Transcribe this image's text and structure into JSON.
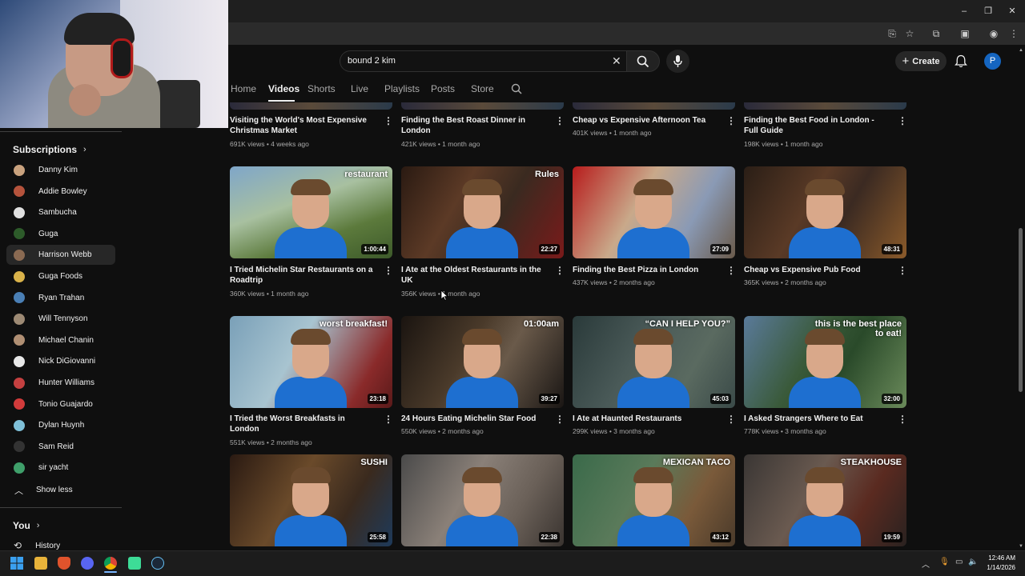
{
  "search": {
    "query": "bound 2 kim"
  },
  "header": {
    "create_label": "Create",
    "account_initial": "P"
  },
  "channel_tabs": [
    "Home",
    "Videos",
    "Shorts",
    "Live",
    "Playlists",
    "Posts",
    "Store"
  ],
  "sidebar": {
    "subscriptions_heading": "Subscriptions",
    "subscriptions": [
      {
        "name": "Danny Kim",
        "color": "#c9a27e"
      },
      {
        "name": "Addie Bowley",
        "color": "#b5533c"
      },
      {
        "name": "Sambucha",
        "color": "#e0e0e0"
      },
      {
        "name": "Guga",
        "color": "#2d5b2a"
      },
      {
        "name": "Harrison Webb",
        "color": "#8a6a52"
      },
      {
        "name": "Guga Foods",
        "color": "#d9b24a"
      },
      {
        "name": "Ryan Trahan",
        "color": "#4a7fb5"
      },
      {
        "name": "Will Tennyson",
        "color": "#9d8a74"
      },
      {
        "name": "Michael Chanin",
        "color": "#b08f73"
      },
      {
        "name": "Nick DiGiovanni",
        "color": "#e8e8e8"
      },
      {
        "name": "Hunter Williams",
        "color": "#c44040"
      },
      {
        "name": "Tonio Guajardo",
        "color": "#d23b3b"
      },
      {
        "name": "Dylan Huynh",
        "color": "#7fc0d8"
      },
      {
        "name": "Sam Reid",
        "color": "#333333"
      },
      {
        "name": "sir yacht",
        "color": "#3f9f6a"
      }
    ],
    "show_less_label": "Show less",
    "you_heading": "You",
    "history_label": "History"
  },
  "videos_top_row": [
    {
      "title": "Visiting the World's Most Expensive Christmas Market",
      "meta": "691K views • 4 weeks ago"
    },
    {
      "title": "Finding the Best Roast Dinner in London",
      "meta": "421K views • 1 month ago"
    },
    {
      "title": "Cheap vs Expensive Afternoon Tea",
      "meta": "401K views • 1 month ago"
    },
    {
      "title": "Finding the Best Food in London - Full Guide",
      "meta": "198K views • 1 month ago"
    }
  ],
  "videos_row2": [
    {
      "title": "I Tried Michelin Star Restaurants on a Roadtrip",
      "meta": "360K views • 1 month ago",
      "duration": "1:00:44",
      "overlay": "restaurant",
      "bg": "linear-gradient(160deg,#7fa6c9 0%,#a8c0a0 40%,#5c7a3c 70%,#3d5a2a 100%)"
    },
    {
      "title": "I Ate at the Oldest Restaurants in the UK",
      "meta": "356K views • 1 month ago",
      "duration": "22:27",
      "overlay": "Rules",
      "bg": "linear-gradient(120deg,#2a1a12 0%,#5c3a26 35%,#3a2a20 60%,#7a1a1a 100%)"
    },
    {
      "title": "Finding the Best Pizza in London",
      "meta": "437K views • 2 months ago",
      "duration": "27:09",
      "overlay": "",
      "bg": "linear-gradient(120deg,#b71c1c 0%,#c9a98a 40%,#8a9ab5 70%,#6a5a4a 100%)"
    },
    {
      "title": "Cheap vs Expensive Pub Food",
      "meta": "365K views • 2 months ago",
      "duration": "48:31",
      "overlay": "",
      "bg": "linear-gradient(120deg,#2a1e16 0%,#5a3a26 40%,#3b2a22 60%,#8a5a2a 100%)"
    }
  ],
  "videos_row3": [
    {
      "title": "I Tried the Worst Breakfasts in London",
      "meta": "551K views • 2 months ago",
      "duration": "23:18",
      "overlay": "worst breakfast!",
      "bg": "linear-gradient(120deg,#7aa0b8 0%,#a8c4d0 40%,#8a2a2a 80%,#5a1a1a 100%)"
    },
    {
      "title": "24 Hours Eating Michelin Star Food",
      "meta": "550K views • 2 months ago",
      "duration": "39:27",
      "overlay": "01:00am",
      "bg": "linear-gradient(120deg,#1a1410 0%,#4a3a2a 40%,#6a5a4a 60%,#1a1614 100%)"
    },
    {
      "title": "I Ate at Haunted Restaurants",
      "meta": "299K views • 3 months ago",
      "duration": "45:03",
      "overlay": "“CAN I HELP YOU?”",
      "bg": "linear-gradient(120deg,#2a3a3a 0%,#4a5a58 40%,#5a6a60 70%,#3a4a48 100%)"
    },
    {
      "title": "I Asked Strangers Where to Eat",
      "meta": "778K views • 3 months ago",
      "duration": "32:00",
      "overlay": "this is the best place to eat!",
      "bg": "linear-gradient(120deg,#5a7a9a 0%,#3a5a3a 40%,#2a4a2a 60%,#6a8a5a 100%)"
    }
  ],
  "videos_row4": [
    {
      "duration": "25:58",
      "overlay": "SUSHI",
      "bg": "linear-gradient(120deg,#2a1a12 0%,#6a4a2a 40%,#3a2a1e 70%,#1e3a5a 100%)"
    },
    {
      "duration": "22:38",
      "overlay": "",
      "bg": "linear-gradient(120deg,#4a4a4a 0%,#8a8078 40%,#6a6058 70%,#3a3430 100%)"
    },
    {
      "duration": "43:12",
      "overlay": "MEXICAN TACO",
      "bg": "linear-gradient(120deg,#3a6a4a 0%,#5a7a5a 40%,#7a5a3a 70%,#4a3a2a 100%)"
    },
    {
      "duration": "19:59",
      "overlay": "STEAKHOUSE",
      "bg": "linear-gradient(120deg,#3a3634 0%,#6a5a50 40%,#5a2a20 70%,#2a2220 100%)"
    }
  ],
  "taskbar": {
    "time": "12:46 AM",
    "date": "1/14/2026"
  }
}
